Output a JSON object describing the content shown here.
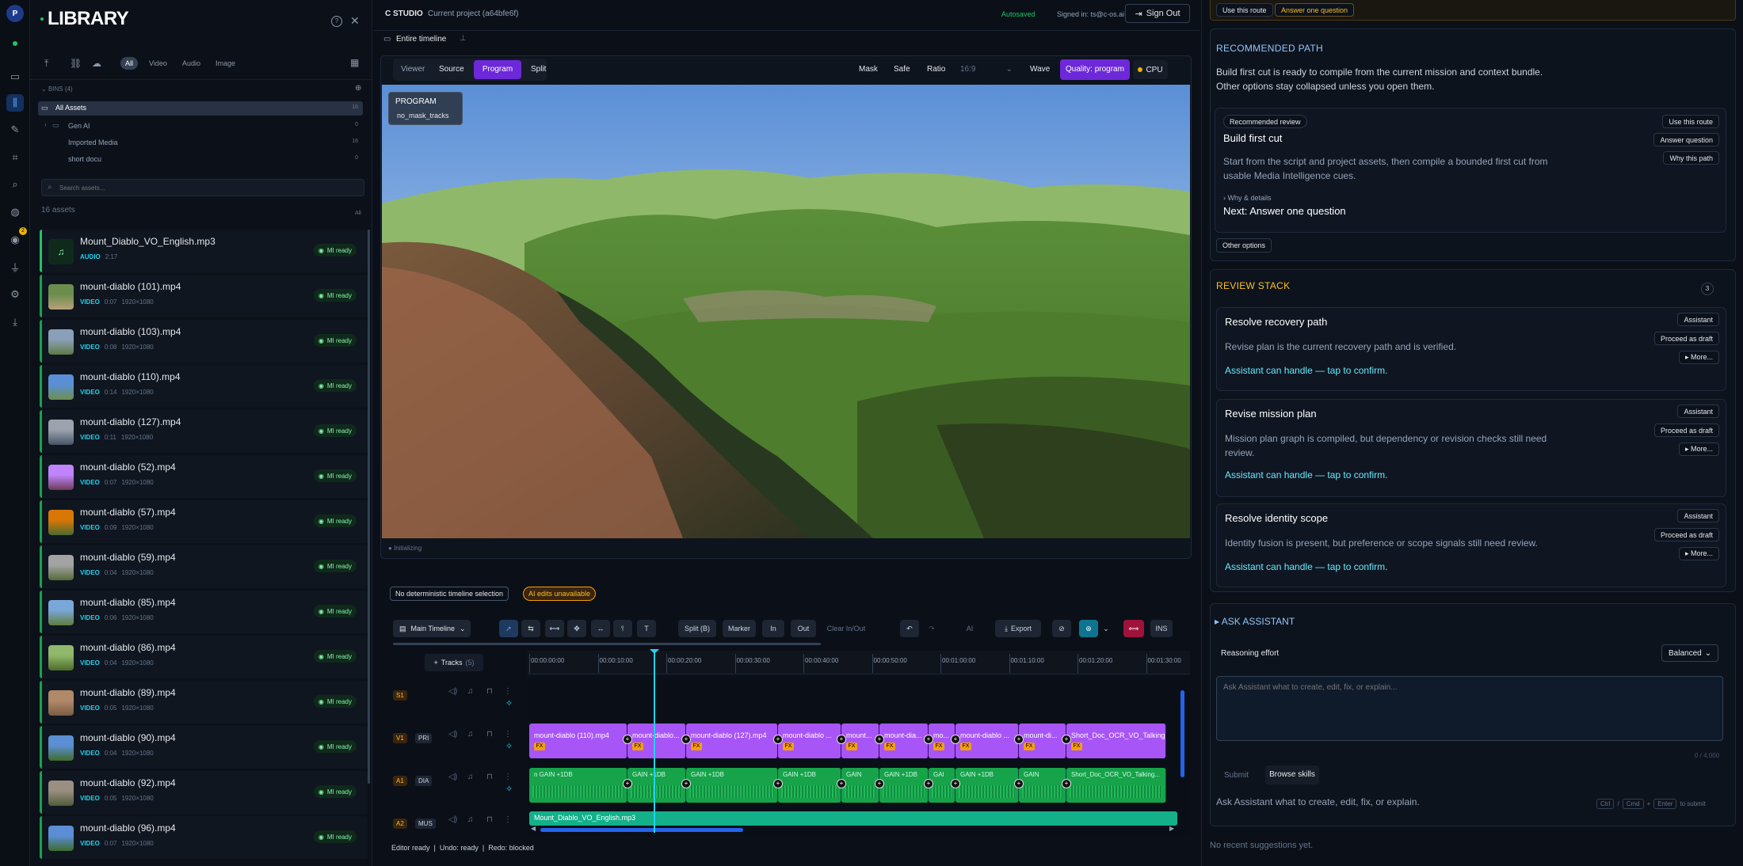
{
  "rail": {
    "avatar": "P",
    "badge": "2"
  },
  "library": {
    "title": "LIBRARY",
    "filters": [
      "All",
      "Video",
      "Audio",
      "Image"
    ],
    "bins_label": "BINS",
    "bins_count": "(4)",
    "bins": [
      {
        "name": "All Assets",
        "count": "16"
      },
      {
        "name": "Gen AI",
        "count": "0"
      },
      {
        "name": "Imported Media",
        "count": "16"
      },
      {
        "name": "short docu",
        "count": "0"
      }
    ],
    "search_placeholder": "Search assets...",
    "asset_count": "16 assets",
    "sort_label": "All",
    "assets": [
      {
        "name": "Mount_Diablo_VO_English.mp3",
        "type": "AUDIO",
        "dur": "2:17",
        "res": "",
        "badge": "MI ready"
      },
      {
        "name": "mount-diablo (101).mp4",
        "type": "VIDEO",
        "dur": "0:07",
        "res": "1920×1080",
        "badge": "MI ready"
      },
      {
        "name": "mount-diablo (103).mp4",
        "type": "VIDEO",
        "dur": "0:08",
        "res": "1920×1080",
        "badge": "MI ready"
      },
      {
        "name": "mount-diablo (110).mp4",
        "type": "VIDEO",
        "dur": "0:14",
        "res": "1920×1080",
        "badge": "MI ready"
      },
      {
        "name": "mount-diablo (127).mp4",
        "type": "VIDEO",
        "dur": "0:11",
        "res": "1920×1080",
        "badge": "MI ready"
      },
      {
        "name": "mount-diablo (52).mp4",
        "type": "VIDEO",
        "dur": "0:07",
        "res": "1920×1080",
        "badge": "MI ready"
      },
      {
        "name": "mount-diablo (57).mp4",
        "type": "VIDEO",
        "dur": "0:09",
        "res": "1920×1080",
        "badge": "MI ready"
      },
      {
        "name": "mount-diablo (59).mp4",
        "type": "VIDEO",
        "dur": "0:04",
        "res": "1920×1080",
        "badge": "MI ready"
      },
      {
        "name": "mount-diablo (85).mp4",
        "type": "VIDEO",
        "dur": "0:06",
        "res": "1920×1080",
        "badge": "MI ready"
      },
      {
        "name": "mount-diablo (86).mp4",
        "type": "VIDEO",
        "dur": "0:04",
        "res": "1920×1080",
        "badge": "MI ready"
      },
      {
        "name": "mount-diablo (89).mp4",
        "type": "VIDEO",
        "dur": "0:05",
        "res": "1920×1080",
        "badge": "MI ready"
      },
      {
        "name": "mount-diablo (90).mp4",
        "type": "VIDEO",
        "dur": "0:04",
        "res": "1920×1080",
        "badge": "MI ready"
      },
      {
        "name": "mount-diablo (92).mp4",
        "type": "VIDEO",
        "dur": "0:05",
        "res": "1920×1080",
        "badge": "MI ready"
      },
      {
        "name": "mount-diablo (96).mp4",
        "type": "VIDEO",
        "dur": "0:07",
        "res": "1920×1080",
        "badge": "MI ready"
      }
    ]
  },
  "header": {
    "app": "C STUDIO",
    "project": "Current project (a64bfe6f)",
    "autosave": "Autosaved",
    "signed_in": "Signed in: ts@c-os.ai",
    "sign_out": "Sign Out",
    "tab": "Entire timeline"
  },
  "viewer": {
    "tabs": [
      "Viewer",
      "Source",
      "Program",
      "Split"
    ],
    "active_tab": "Program",
    "tools": [
      "Mask",
      "Safe",
      "Ratio"
    ],
    "ratio": "16:9",
    "wave": "Wave",
    "quality": "Quality: program",
    "cpu": "CPU",
    "overlay_title": "PROGRAM",
    "overlay_sub": "no_mask_tracks",
    "status": "Initializing"
  },
  "timeline": {
    "msg1": "No deterministic timeline selection",
    "msg2": "AI edits unavailable",
    "main_timeline": "Main Timeline",
    "split": "Split (B)",
    "marker": "Marker",
    "in": "In",
    "out": "Out",
    "clear": "Clear In/Out",
    "ai": "AI",
    "export": "Export",
    "ins": "INS",
    "tracks_label": "Tracks",
    "tracks_count": "(5)",
    "ticks": [
      "00:00:00:00",
      "00:00:10:00",
      "00:00:20:00",
      "00:00:30:00",
      "00:00:40:00",
      "00:00:50:00",
      "00:01:00:00",
      "00:01:10:00",
      "00:01:20:00",
      "00:01:30:00"
    ],
    "tracks": [
      {
        "id": "S1",
        "tag": ""
      },
      {
        "id": "V1",
        "tag": "PRI"
      },
      {
        "id": "A1",
        "tag": "DIA"
      },
      {
        "id": "A2",
        "tag": "MUS"
      }
    ],
    "video_clips": [
      "mount-diablo (110).mp4",
      "mount-diablo...",
      "mount-diablo (127).mp4",
      "mount-diablo ...",
      "mount...",
      "mount-dia...",
      "mo...",
      "mount-diablo ...",
      "mount-di...",
      "Short_Doc_OCR_VO_Talking_he"
    ],
    "audio_clips": [
      "n  GAIN +1DB",
      "GAIN +1DB",
      "GAIN +1DB",
      "GAIN +1DB",
      "GAIN",
      "GAIN +1DB",
      "GAI",
      "GAIN +1DB",
      "GAIN",
      "Short_Doc_OCR_VO_Talking..."
    ],
    "music_clip": "Mount_Diablo_VO_English.mp3",
    "footer": "Editor ready  |  Undo: ready  |  Redo: blocked"
  },
  "right": {
    "top_btn1": "Use this route",
    "top_btn2": "Answer one question",
    "rec_title": "RECOMMENDED PATH",
    "rec_text1": "Build first cut is ready to compile from the current mission and context bundle.",
    "rec_text2": "Other options stay collapsed unless you open them.",
    "rec_card": {
      "badge": "Recommended review",
      "title": "Build first cut",
      "body1": "Start from the script and project assets, then compile a bounded first cut from",
      "body2": "usable Media Intelligence cues.",
      "why": "› Why & details",
      "next": "Next: Answer one question",
      "btn1": "Use this route",
      "btn2": "Answer question",
      "btn3": "Why this path"
    },
    "other_options": "Other options",
    "review_title": "REVIEW STACK",
    "review_count": "3",
    "reviews": [
      {
        "title": "Resolve recovery path",
        "body": "Revise plan is the current recovery path and is verified.",
        "body2": "",
        "action": "Assistant can handle — tap to confirm.",
        "tag": "Assistant",
        "draft": "Proceed as draft",
        "more": "▸ More..."
      },
      {
        "title": "Revise mission plan",
        "body": "Mission plan graph is compiled, but dependency or revision checks still need",
        "body2": "review.",
        "action": "Assistant can handle — tap to confirm.",
        "tag": "Assistant",
        "draft": "Proceed as draft",
        "more": "▸ More..."
      },
      {
        "title": "Resolve identity scope",
        "body": "Identity fusion is present, but preference or scope signals still need review.",
        "body2": "",
        "action": "Assistant can handle — tap to confirm.",
        "tag": "Assistant",
        "draft": "Proceed as draft",
        "more": "▸ More..."
      }
    ],
    "ask_title": "ASK ASSISTANT",
    "reasoning_label": "Reasoning effort",
    "reasoning_value": "Balanced",
    "ask_placeholder": "Ask Assistant what to create, edit, fix, or explain...",
    "char_count": "0 / 4,000",
    "submit": "Submit",
    "browse": "Browse skills",
    "hint": "Ask Assistant what to create, edit, fix, or explain.",
    "keys": [
      "Ctrl",
      "Cmd",
      "Enter"
    ],
    "keys_suffix": "to submit",
    "no_suggestions": "No recent suggestions yet."
  }
}
